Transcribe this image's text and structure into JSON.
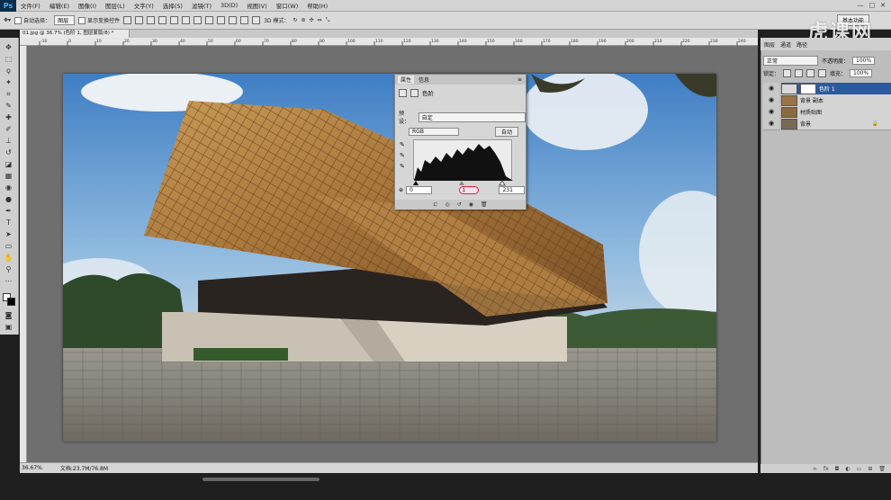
{
  "app": {
    "logo": "Ps"
  },
  "menu": [
    "文件(F)",
    "编辑(E)",
    "图像(I)",
    "图层(L)",
    "文字(Y)",
    "选择(S)",
    "滤镜(T)",
    "3D(D)",
    "视图(V)",
    "窗口(W)",
    "帮助(H)"
  ],
  "window_controls": [
    "—",
    "□",
    "✕"
  ],
  "options_bar": {
    "auto_select_label": "自动选择：",
    "auto_select_value": "图层",
    "show_transform_label": "显示变换控件",
    "mode_3d_label": "3D 模式："
  },
  "workspace": "基本功能",
  "doc_tab": "01.jpg @ 36.7% (色阶 1, 图层蒙版/8) *",
  "ruler_ticks": [
    "-10",
    "0",
    "10",
    "20",
    "30",
    "40",
    "50",
    "60",
    "70",
    "80",
    "90",
    "100",
    "110",
    "120",
    "130",
    "140",
    "150",
    "160",
    "170",
    "180",
    "190",
    "200",
    "210",
    "220",
    "230",
    "240"
  ],
  "status": {
    "zoom": "36.67%",
    "doc_size": "文档:23.7M/76.8M"
  },
  "watermark": "虎课网",
  "properties": {
    "tabs": [
      "属性",
      "信息"
    ],
    "title": "色阶",
    "preset_label": "预设：",
    "preset_value": "自定",
    "channel_value": "RGB",
    "auto_label": "自动",
    "input_black": "0",
    "input_mid": "1",
    "input_white": "231",
    "bottom_icons": [
      "clip-icon",
      "view-icon",
      "reset-icon",
      "visibility-icon",
      "trash-icon"
    ]
  },
  "layers_panel": {
    "tabs": [
      "图层",
      "通道",
      "路径"
    ],
    "blend_mode": "正常",
    "opacity_label": "不透明度：",
    "opacity_value": "100%",
    "lock_label": "锁定：",
    "fill_label": "填充：",
    "fill_value": "100%",
    "layers": [
      {
        "name": "色阶 1",
        "active": true
      },
      {
        "name": "背景 副本",
        "active": false
      },
      {
        "name": "材质贴图",
        "active": false
      },
      {
        "name": "背景",
        "active": false
      }
    ],
    "bottom_icons": [
      "link-icon",
      "fx-icon",
      "mask-icon",
      "adjustment-icon",
      "group-icon",
      "new-layer-icon",
      "trash-icon"
    ]
  }
}
